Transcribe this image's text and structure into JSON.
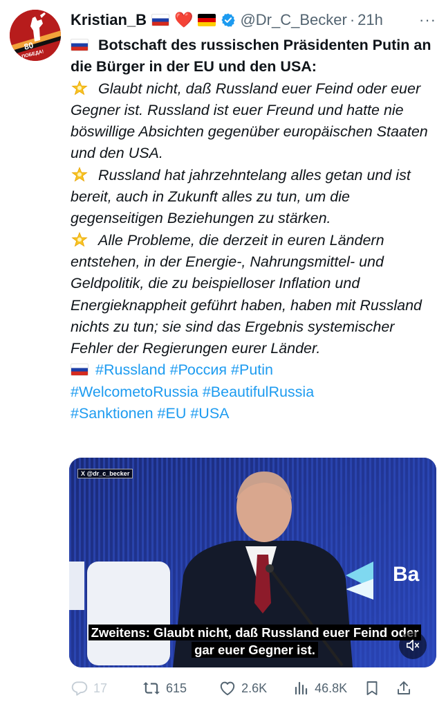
{
  "avatar": {
    "badge_number": "80",
    "badge_text": "ПОБЕДА!"
  },
  "header": {
    "display_name": "Kristian_B",
    "emoji_heart": "❤️",
    "handle": "@Dr_C_Becker",
    "separator": "·",
    "time": "21h",
    "more": "···"
  },
  "post": {
    "title": "Botschaft des russischen Präsidenten Putin an die Bürger in der EU und den USA:",
    "paragraphs": [
      "Glaubt nicht, daß Russland euer Feind oder euer Gegner ist. Russland ist euer Freund und hatte nie böswillige Absichten gegenüber europäischen Staaten und den USA.",
      "Russland hat jahrzehntelang alles getan und ist bereit, auch in Zukunft alles zu tun, um die gegenseitigen Beziehungen zu stärken.",
      "Alle Probleme, die derzeit in euren Ländern entstehen, in der Energie-, Nahrungsmittel- und Geldpolitik, die zu beispielloser Inflation und Energieknappheit geführt haben, haben mit Russland nichts zu tun; sie sind das Ergebnis systemischer Fehler der Regierungen eurer Länder."
    ],
    "hashtags": [
      "#Russland",
      "#Россия",
      "#Putin",
      "#WelcometoRussia",
      "#BeautifulRussia",
      "#Sanktionen",
      "#EU",
      "#USA"
    ]
  },
  "media": {
    "watermark": "X @dr_c_becker",
    "backdrop_text": "Ва",
    "subtitle_line1": "Zweitens: Glaubt nicht, daß Russland euer Feind oder",
    "subtitle_line2": "gar euer Gegner ist.",
    "mute_icon": "speaker-muted-icon"
  },
  "actions": {
    "replies": "17",
    "reposts": "615",
    "likes": "2.6K",
    "views": "46.8K"
  },
  "colors": {
    "link": "#1d9bf0",
    "secondary_text": "#536471",
    "verified": "#1d9bf0",
    "heart": "#e0245e"
  }
}
